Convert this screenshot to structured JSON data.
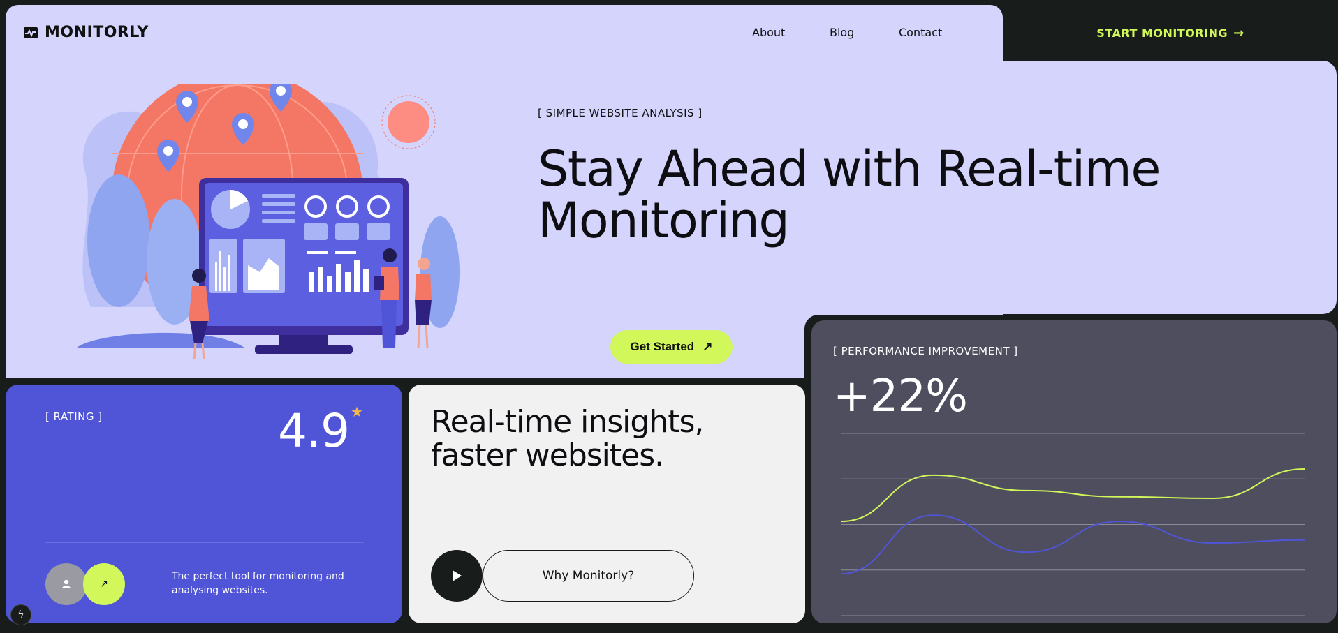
{
  "header": {
    "logo_text": "MONITORLY",
    "nav": [
      {
        "label": "About"
      },
      {
        "label": "Blog"
      },
      {
        "label": "Contact"
      }
    ],
    "cta_label": "START  MONITORING",
    "cta_icon": "arrow-right-icon"
  },
  "hero": {
    "eyebrow": "[ SIMPLE WEBSITE ANALYSIS ]",
    "headline_line1": "Stay Ahead with Real-time",
    "headline_line2": "Monitoring",
    "button_label": "Get Started",
    "button_icon": "arrow-up-right-icon"
  },
  "rating_card": {
    "label": "[ RATING ]",
    "value": "4.9",
    "star_icon": "star-icon",
    "description": "The perfect tool for monitoring and analysing websites."
  },
  "insights_card": {
    "title_line1": "Real-time insights,",
    "title_line2": "faster websites.",
    "play_icon": "play-icon",
    "button_label": "Why Monitorly?"
  },
  "performance_card": {
    "label": "[ PERFORMANCE IMPROVEMENT ]",
    "value": "+22%"
  },
  "colors": {
    "accent": "#d2f75a",
    "hero_bg": "#d4d4fd",
    "rating_bg": "#4f55d6",
    "perf_bg": "#4f4e5f",
    "dark": "#181c1b"
  },
  "chart_data": {
    "type": "line",
    "series": [
      {
        "color": "#d2f75a",
        "values": [
          62,
          92,
          82,
          78,
          77,
          96
        ]
      },
      {
        "color": "#4f55d6",
        "values": [
          28,
          66,
          42,
          62,
          48,
          50
        ]
      }
    ],
    "x": [
      0,
      1,
      2,
      3,
      4,
      5
    ],
    "ylim": [
      0,
      120
    ],
    "grid": true
  }
}
